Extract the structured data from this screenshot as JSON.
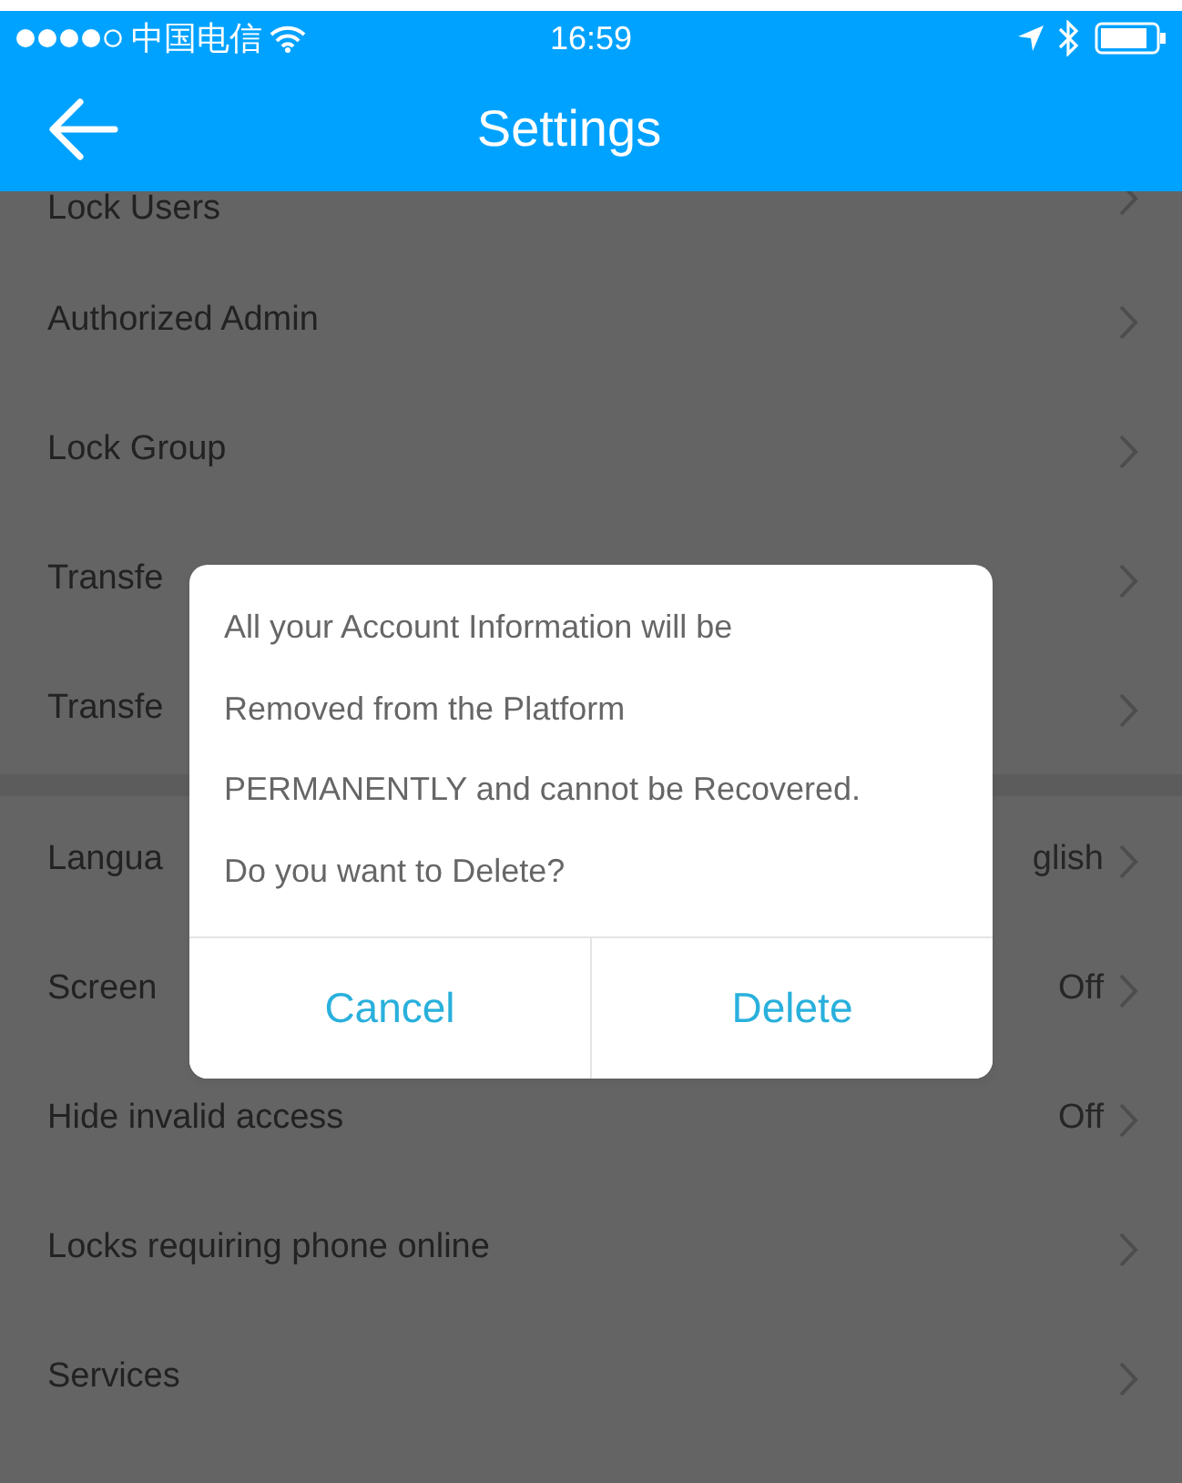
{
  "status_bar": {
    "carrier": "中国电信",
    "time": "16:59"
  },
  "nav_bar": {
    "title": "Settings"
  },
  "sections": [
    {
      "rows": [
        {
          "label": "Lock Users"
        },
        {
          "label": "Authorized Admin"
        },
        {
          "label": "Lock Group"
        },
        {
          "label": "Transfe"
        },
        {
          "label": "Transfe"
        }
      ]
    },
    {
      "rows": [
        {
          "label": "Langua",
          "value": "glish"
        },
        {
          "label": "Screen",
          "value": "Off"
        },
        {
          "label": "Hide invalid access",
          "value": "Off"
        },
        {
          "label": "Locks requiring phone online"
        },
        {
          "label": "Services"
        }
      ]
    }
  ],
  "dialog": {
    "message": "All your Account Information will be Removed from the Platform PERMANENTLY and cannot be Recovered. Do you want to Delete?",
    "buttons": [
      {
        "label": "Cancel"
      },
      {
        "label": "Delete"
      }
    ]
  }
}
